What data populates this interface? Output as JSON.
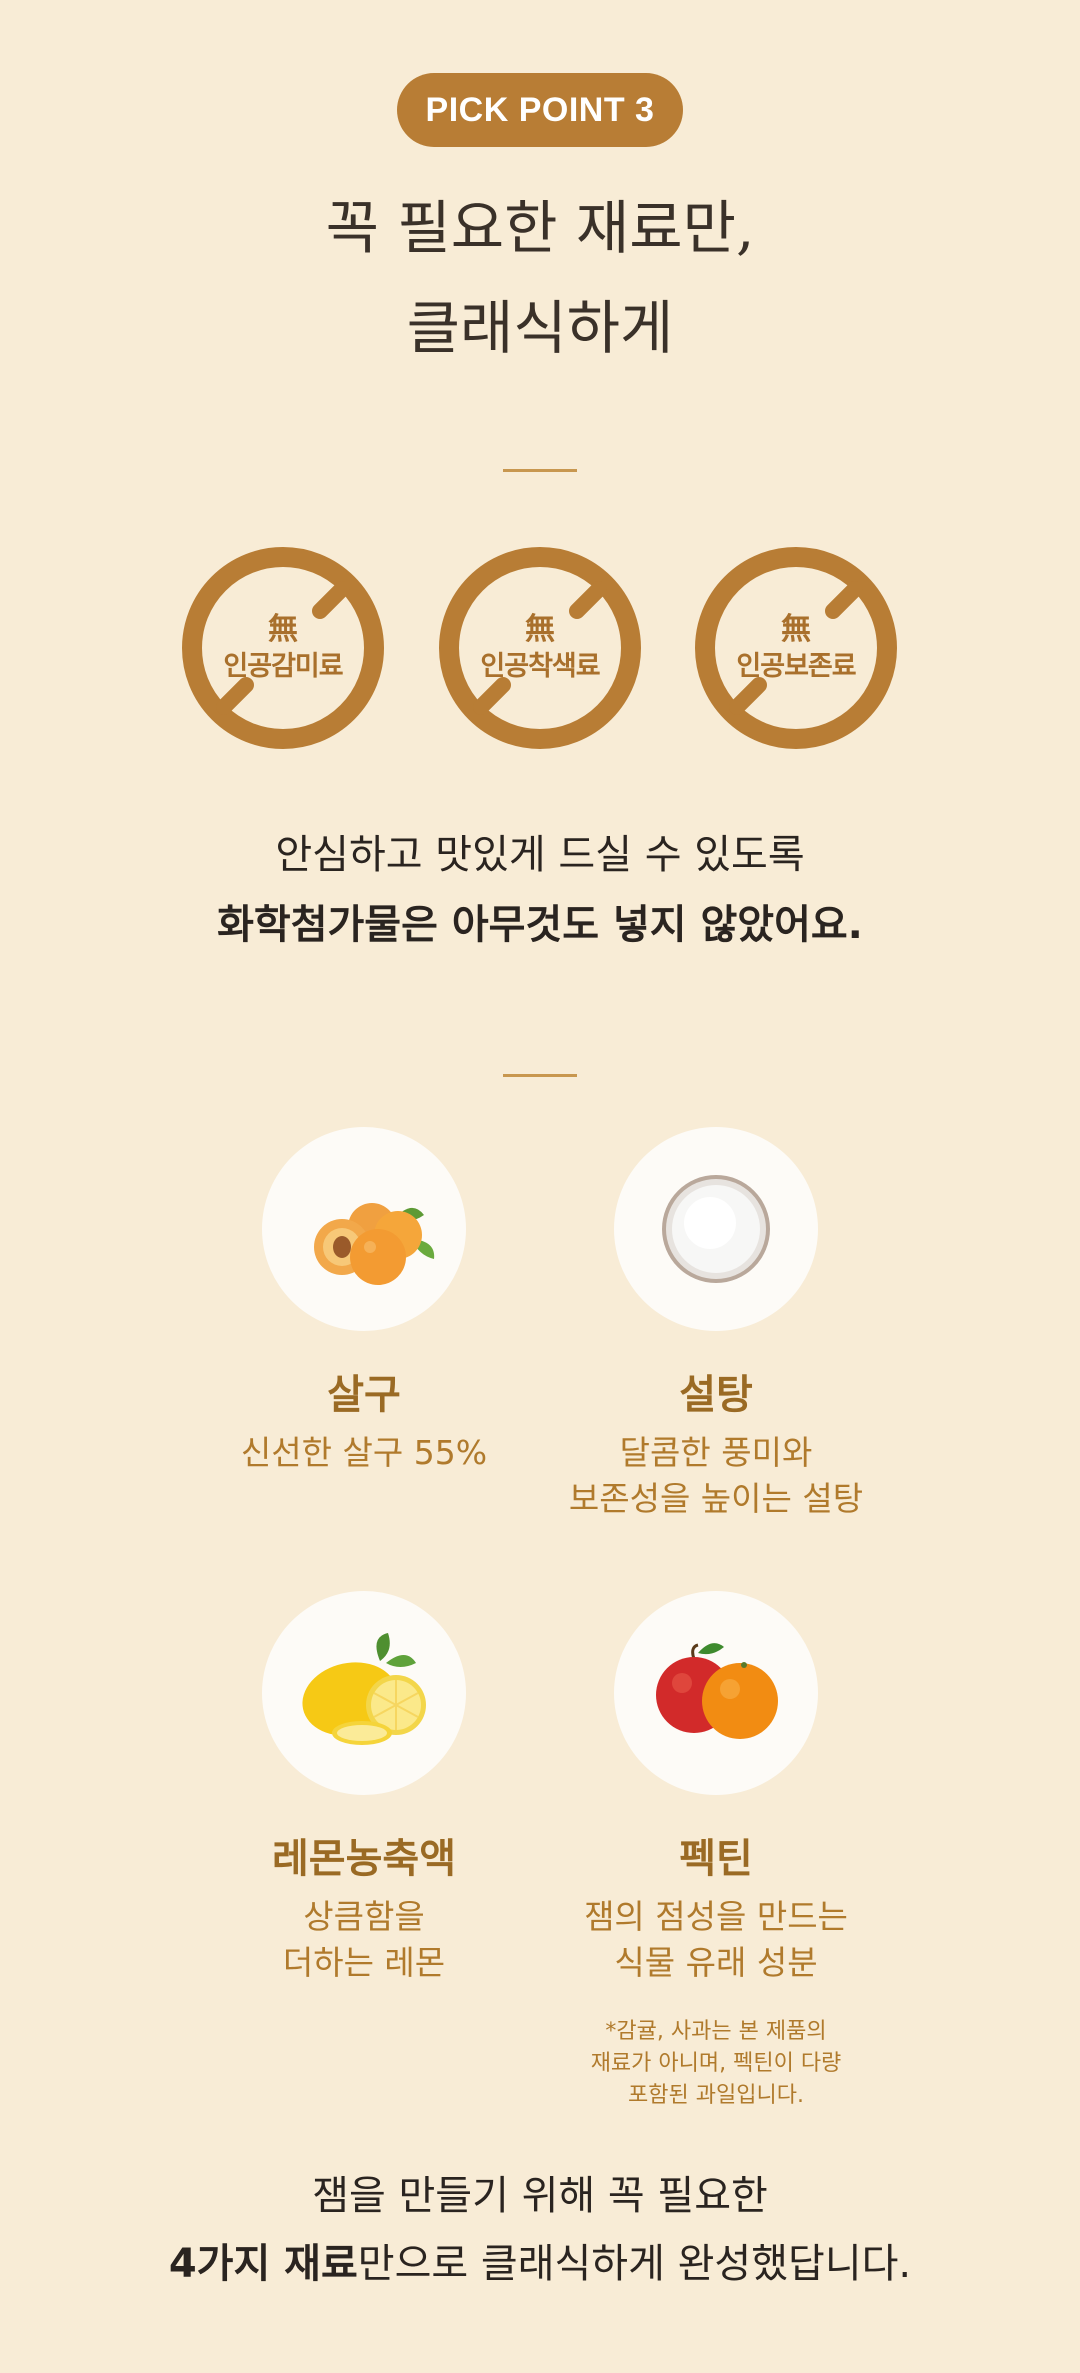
{
  "badge": "PICK POINT 3",
  "title": {
    "line1": "꼭 필요한 재료만,",
    "line2": "클래식하게"
  },
  "free_badges": [
    {
      "mark": "無",
      "label": "인공감미료"
    },
    {
      "mark": "無",
      "label": "인공착색료"
    },
    {
      "mark": "無",
      "label": "인공보존료"
    }
  ],
  "statement": {
    "line1": "안심하고 맛있게 드실 수 있도록",
    "line2": "화학첨가물은 아무것도 넣지 않았어요."
  },
  "ingredients": [
    {
      "icon": "apricot-icon",
      "name": "살구",
      "desc1": "신선한 살구 55%",
      "desc2": ""
    },
    {
      "icon": "sugar-bowl-icon",
      "name": "설탕",
      "desc1": "달콤한 풍미와",
      "desc2": "보존성을 높이는 설탕"
    },
    {
      "icon": "lemon-icon",
      "name": "레몬농축액",
      "desc1": "상큼함을",
      "desc2": "더하는 레몬"
    },
    {
      "icon": "apple-orange-icon",
      "name": "펙틴",
      "desc1": "잼의 점성을 만드는",
      "desc2": "식물 유래 성분"
    }
  ],
  "pectin_note": {
    "line1": "*감귤, 사과는 본 제품의",
    "line2": "재료가 아니며, 펙틴이 다량",
    "line3": "포함된 과일입니다."
  },
  "closing": {
    "line1": "잼을 만들기 위해 꼭 필요한",
    "line2_bold": "4가지 재료",
    "line2_rest": "만으로 클래식하게 완성했답니다."
  },
  "colors": {
    "background": "#f8ecd6",
    "accent": "#b87d35",
    "ingredient_text": "#9a6a24"
  }
}
